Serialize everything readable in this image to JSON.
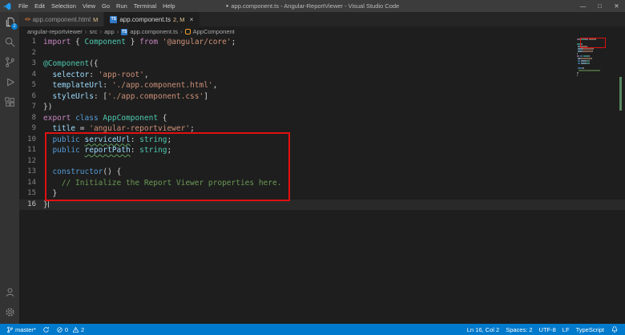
{
  "window": {
    "dirty_indicator": "●",
    "title": "app.component.ts - Angular-ReportViewer - Visual Studio Code",
    "menus": [
      "File",
      "Edit",
      "Selection",
      "View",
      "Go",
      "Run",
      "Terminal",
      "Help"
    ],
    "controls": [
      {
        "name": "minimize",
        "glyph": "—"
      },
      {
        "name": "maximize",
        "glyph": "□"
      },
      {
        "name": "close",
        "glyph": "✕"
      }
    ]
  },
  "activity_bar": {
    "items": [
      {
        "name": "explorer",
        "badge": "2"
      },
      {
        "name": "search"
      },
      {
        "name": "source-control"
      },
      {
        "name": "run-and-debug"
      },
      {
        "name": "extensions"
      }
    ],
    "bottom": [
      {
        "name": "accounts"
      },
      {
        "name": "settings"
      }
    ]
  },
  "icons": {
    "ts_label": "TS",
    "html_label": "<>"
  },
  "tabs": [
    {
      "label": "app.component.html",
      "badge": "M",
      "icon": "html",
      "active": false
    },
    {
      "label": "app.component.ts",
      "badge": "2, M",
      "icon": "ts",
      "active": true,
      "close": "×"
    }
  ],
  "breadcrumb": {
    "separator": "›",
    "items": [
      "angular-reportviewer",
      "src",
      "app",
      "app.component.ts",
      "AppComponent"
    ]
  },
  "editor": {
    "cursor": {
      "line": 16,
      "col": 2
    },
    "lines": [
      [
        {
          "t": "import",
          "c": "k"
        },
        {
          "t": " { ",
          "c": "p"
        },
        {
          "t": "Component",
          "c": "t"
        },
        {
          "t": " } ",
          "c": "p"
        },
        {
          "t": "from",
          "c": "k"
        },
        {
          "t": " ",
          "c": "p"
        },
        {
          "t": "'@angular/core'",
          "c": "s"
        },
        {
          "t": ";",
          "c": "p"
        }
      ],
      [],
      [
        {
          "t": "@Component",
          "c": "t"
        },
        {
          "t": "({",
          "c": "p"
        }
      ],
      [
        {
          "t": "  ",
          "c": "p"
        },
        {
          "t": "selector",
          "c": "v"
        },
        {
          "t": ": ",
          "c": "p"
        },
        {
          "t": "'app-root'",
          "c": "s"
        },
        {
          "t": ",",
          "c": "p"
        }
      ],
      [
        {
          "t": "  ",
          "c": "p"
        },
        {
          "t": "templateUrl",
          "c": "v"
        },
        {
          "t": ": ",
          "c": "p"
        },
        {
          "t": "'./app.component.html'",
          "c": "s"
        },
        {
          "t": ",",
          "c": "p"
        }
      ],
      [
        {
          "t": "  ",
          "c": "p"
        },
        {
          "t": "styleUrls",
          "c": "v"
        },
        {
          "t": ": [",
          "c": "p"
        },
        {
          "t": "'./app.component.css'",
          "c": "s"
        },
        {
          "t": "]",
          "c": "p"
        }
      ],
      [
        {
          "t": "})",
          "c": "p"
        }
      ],
      [
        {
          "t": "export",
          "c": "k"
        },
        {
          "t": " ",
          "c": "p"
        },
        {
          "t": "class",
          "c": "b"
        },
        {
          "t": " ",
          "c": "p"
        },
        {
          "t": "AppComponent",
          "c": "t"
        },
        {
          "t": " {",
          "c": "p"
        }
      ],
      [
        {
          "t": "  ",
          "c": "p"
        },
        {
          "t": "title",
          "c": "v"
        },
        {
          "t": " = ",
          "c": "p"
        },
        {
          "t": "'angular-reportviewer'",
          "c": "s"
        },
        {
          "t": ";",
          "c": "p"
        }
      ],
      [
        {
          "t": "  ",
          "c": "p"
        },
        {
          "t": "public",
          "c": "b"
        },
        {
          "t": " ",
          "c": "p"
        },
        {
          "t": "serviceUrl",
          "c": "v",
          "u": true
        },
        {
          "t": ": ",
          "c": "p"
        },
        {
          "t": "string",
          "c": "t"
        },
        {
          "t": ";",
          "c": "p"
        }
      ],
      [
        {
          "t": "  ",
          "c": "p"
        },
        {
          "t": "public",
          "c": "b"
        },
        {
          "t": " ",
          "c": "p"
        },
        {
          "t": "reportPath",
          "c": "v",
          "u": true
        },
        {
          "t": ": ",
          "c": "p"
        },
        {
          "t": "string",
          "c": "t"
        },
        {
          "t": ";",
          "c": "p"
        }
      ],
      [],
      [
        {
          "t": "  ",
          "c": "p"
        },
        {
          "t": "constructor",
          "c": "b"
        },
        {
          "t": "() {",
          "c": "p"
        }
      ],
      [
        {
          "t": "    ",
          "c": "p"
        },
        {
          "t": "// Initialize the Report Viewer properties here.",
          "c": "c"
        }
      ],
      [
        {
          "t": "  }",
          "c": "p"
        }
      ],
      [
        {
          "t": "}",
          "c": "p"
        }
      ]
    ]
  },
  "status_bar": {
    "branch": "master*",
    "errors": "0",
    "warnings": "2",
    "line_col": "Ln 16, Col 2",
    "indent": "Spaces: 2",
    "encoding": "UTF-8",
    "eol": "LF",
    "language": "TypeScript"
  },
  "colors": {
    "accent": "#007acc",
    "annotation": "#e01010",
    "modified_badge": "#e2c08d"
  }
}
